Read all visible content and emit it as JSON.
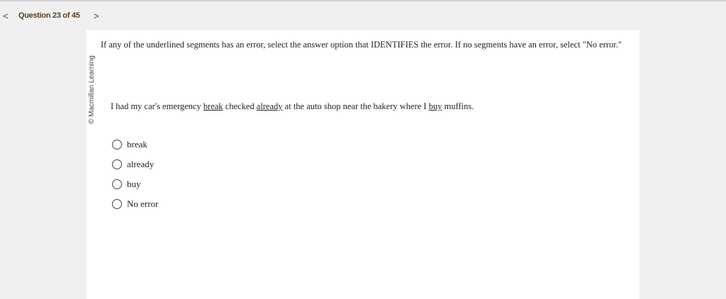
{
  "nav": {
    "question_label": "Question 23 of 45",
    "prev_icon": "chevron-left-icon",
    "next_icon": "chevron-right-icon",
    "prev_glyph": "<",
    "next_glyph": ">"
  },
  "copyright": "© Macmillan Learning",
  "instructions": "If any of the underlined segments has an error, select the answer option that IDENTIFIES the error. If no segments have an error, select \"No error.\"",
  "sentence": {
    "parts": [
      "I had my car's emergency ",
      "break",
      " checked ",
      "already",
      " at the auto shop near the bakery where I ",
      "buy",
      " muffins."
    ]
  },
  "options": [
    "break",
    "already",
    "buy",
    "No error"
  ],
  "colors": {
    "nav_text": "#5b4020",
    "background": "#f0f0f0",
    "card": "#ffffff"
  }
}
